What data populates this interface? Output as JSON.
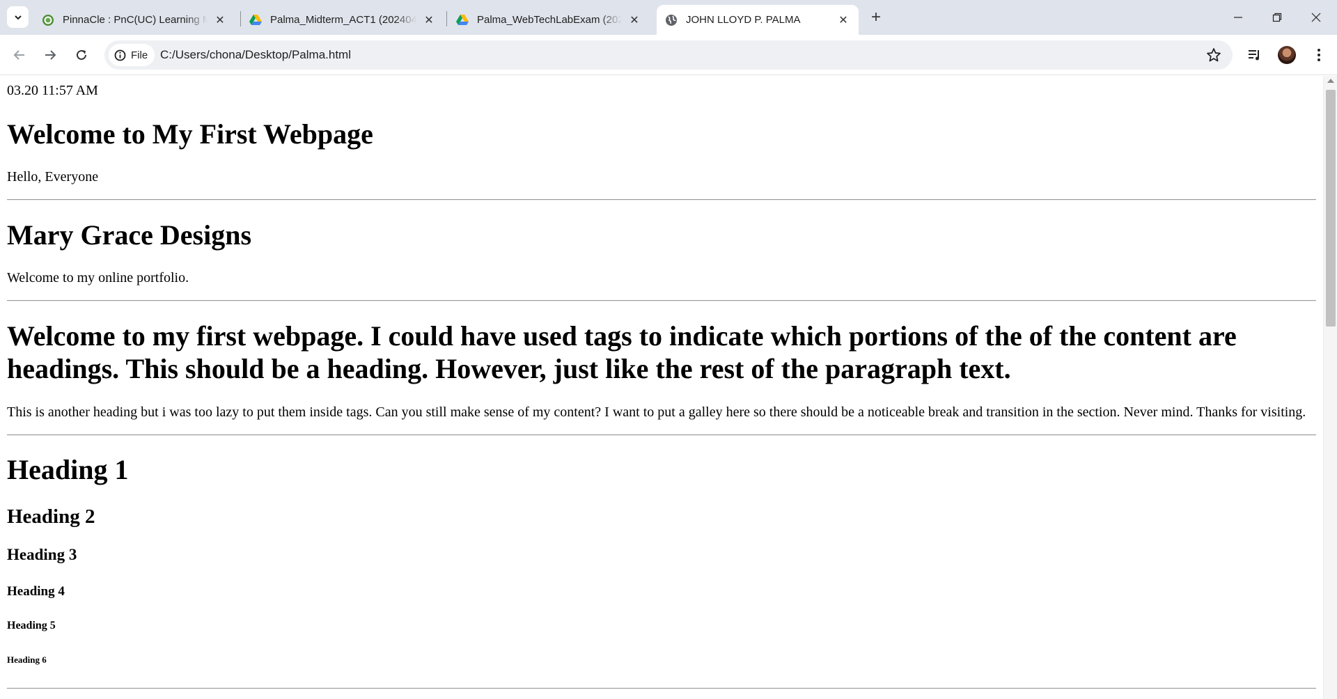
{
  "browser": {
    "tabs": [
      {
        "title": "PinnaCle : PnC(UC) Learning Ma",
        "favicon": "pinnacle-logo-icon",
        "active": false
      },
      {
        "title": "Palma_Midterm_ACT1 (2024041",
        "favicon": "google-drive-icon",
        "active": false
      },
      {
        "title": "Palma_WebTechLabExam (2024",
        "favicon": "google-drive-icon",
        "active": false
      },
      {
        "title": "JOHN LLOYD P. PALMA",
        "favicon": "globe-icon",
        "active": true
      }
    ],
    "address_chip": "File",
    "url": "C:/Users/chona/Desktop/Palma.html",
    "accent": "#dfe3eb"
  },
  "page": {
    "timestamp": "03.20 11:57 AM",
    "title": "Welcome to My First Webpage",
    "greeting": "Hello, Everyone",
    "section2_title": "Mary Grace Designs",
    "section2_text": "Welcome to my online portfolio.",
    "section3_title": "Welcome to my first webpage. I could have used tags to indicate which portions of the of the content are headings. This should be a heading. However, just like the rest of the paragraph text.",
    "section3_text": "This is another heading but i was too lazy to put them inside tags. Can you still make sense of my content? I want to put a galley here so there should be a noticeable break and transition in the section. Never mind. Thanks for visiting.",
    "headings": [
      "Heading 1",
      "Heading 2",
      "Heading 3",
      "Heading 4",
      "Heading 5",
      "Heading 6"
    ]
  }
}
